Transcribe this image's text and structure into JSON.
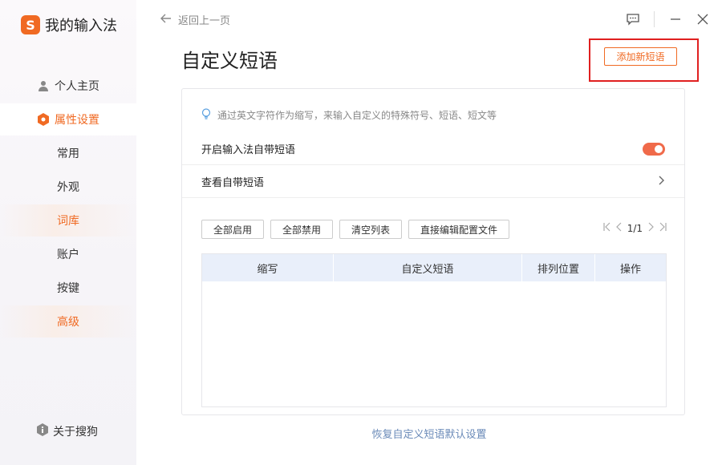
{
  "app": {
    "logo_glyph": "S",
    "title": "我的输入法"
  },
  "sidebar": {
    "items": [
      {
        "label": "个人主页",
        "icon": "user-icon"
      },
      {
        "label": "属性设置",
        "icon": "hexagon-settings-icon"
      }
    ],
    "sub_items": [
      {
        "label": "常用"
      },
      {
        "label": "外观"
      },
      {
        "label": "词库"
      },
      {
        "label": "账户"
      },
      {
        "label": "按键"
      },
      {
        "label": "高级"
      }
    ],
    "about": {
      "label": "关于搜狗",
      "icon": "info-icon"
    }
  },
  "header": {
    "back_label": "返回上一页",
    "window_controls": [
      "feedback-icon",
      "minimize-icon",
      "close-icon"
    ]
  },
  "page": {
    "title": "自定义短语",
    "add_button": "添加新短语"
  },
  "card": {
    "tip": "通过英文字符作为缩写，来输入自定义的特殊符号、短语、短文等",
    "enable_label": "开启输入法自带短语",
    "enable_on": true,
    "view_label": "查看自带短语",
    "actions": [
      "全部启用",
      "全部禁用",
      "清空列表",
      "直接编辑配置文件"
    ],
    "pager": {
      "text": "1/1"
    },
    "table": {
      "columns": [
        "缩写",
        "自定义短语",
        "排列位置",
        "操作"
      ],
      "rows": []
    }
  },
  "footer": {
    "restore_link": "恢复自定义短语默认设置"
  },
  "colors": {
    "accent": "#f06a23",
    "highlight_box": "#e02020",
    "table_header": "#e9effa",
    "link": "#6a8ab8"
  }
}
